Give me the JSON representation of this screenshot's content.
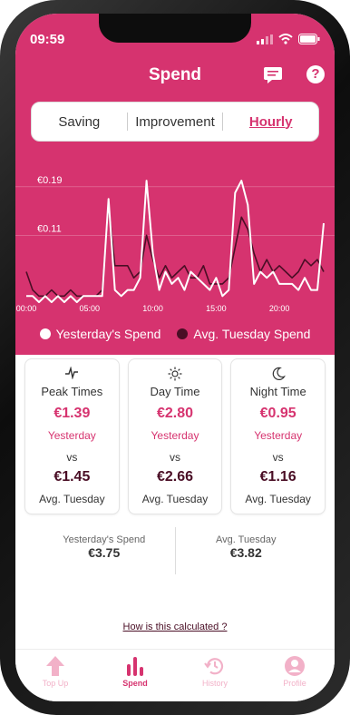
{
  "status": {
    "time": "09:59"
  },
  "header": {
    "title": "Spend"
  },
  "segments": [
    "Saving",
    "Improvement",
    "Hourly"
  ],
  "active_segment": "Hourly",
  "chart_data": {
    "type": "line",
    "x": [
      "00:00",
      "00:30",
      "01:00",
      "01:30",
      "02:00",
      "02:30",
      "03:00",
      "03:30",
      "04:00",
      "04:30",
      "05:00",
      "05:30",
      "06:00",
      "06:30",
      "07:00",
      "07:30",
      "08:00",
      "08:30",
      "09:00",
      "09:30",
      "10:00",
      "10:30",
      "11:00",
      "11:30",
      "12:00",
      "12:30",
      "13:00",
      "13:30",
      "14:00",
      "14:30",
      "15:00",
      "15:30",
      "16:00",
      "16:30",
      "17:00",
      "17:30",
      "18:00",
      "18:30",
      "19:00",
      "19:30",
      "20:00",
      "20:30",
      "21:00",
      "21:30",
      "22:00",
      "22:30",
      "23:00",
      "23:30"
    ],
    "series": [
      {
        "name": "Yesterday's Spend",
        "color": "#ffffff",
        "values": [
          0.01,
          0.01,
          0.0,
          0.01,
          0.0,
          0.01,
          0.0,
          0.01,
          0.0,
          0.01,
          0.01,
          0.01,
          0.01,
          0.17,
          0.02,
          0.01,
          0.02,
          0.02,
          0.04,
          0.2,
          0.08,
          0.02,
          0.05,
          0.03,
          0.04,
          0.02,
          0.05,
          0.04,
          0.03,
          0.02,
          0.04,
          0.01,
          0.02,
          0.18,
          0.2,
          0.16,
          0.03,
          0.05,
          0.04,
          0.05,
          0.03,
          0.03,
          0.03,
          0.02,
          0.04,
          0.02,
          0.02,
          0.13
        ]
      },
      {
        "name": "Avg. Tuesday Spend",
        "color": "#4a0e25",
        "values": [
          0.05,
          0.02,
          0.01,
          0.01,
          0.02,
          0.01,
          0.01,
          0.02,
          0.01,
          0.01,
          0.01,
          0.01,
          0.02,
          0.16,
          0.06,
          0.06,
          0.06,
          0.04,
          0.05,
          0.11,
          0.07,
          0.04,
          0.06,
          0.04,
          0.05,
          0.06,
          0.04,
          0.04,
          0.06,
          0.03,
          0.03,
          0.03,
          0.04,
          0.09,
          0.14,
          0.12,
          0.08,
          0.05,
          0.07,
          0.05,
          0.06,
          0.05,
          0.04,
          0.05,
          0.07,
          0.06,
          0.07,
          0.05
        ]
      }
    ],
    "y_ticks": [
      "€0.19",
      "€0.11"
    ],
    "x_ticks": [
      "00:00",
      "05:00",
      "10:00",
      "15:00",
      "20:00"
    ],
    "ylim": [
      0,
      0.23
    ]
  },
  "legend": {
    "yesterday": "Yesterday's Spend",
    "avg": "Avg. Tuesday Spend"
  },
  "cards": [
    {
      "title": "Peak Times",
      "value": "€1.39",
      "yesterday": "Yesterday",
      "vs": "vs",
      "avg_value": "€1.45",
      "avg_label": "Avg. Tuesday",
      "icon": "pulse-icon"
    },
    {
      "title": "Day Time",
      "value": "€2.80",
      "yesterday": "Yesterday",
      "vs": "vs",
      "avg_value": "€2.66",
      "avg_label": "Avg. Tuesday",
      "icon": "sun-icon"
    },
    {
      "title": "Night Time",
      "value": "€0.95",
      "yesterday": "Yesterday",
      "vs": "vs",
      "avg_value": "€1.16",
      "avg_label": "Avg. Tuesday",
      "icon": "moon-icon"
    }
  ],
  "totals": {
    "yesterday_label": "Yesterday's Spend",
    "yesterday_value": "€3.75",
    "avg_label": "Avg. Tuesday",
    "avg_value": "€3.82"
  },
  "how_link": "How is this calculated ?",
  "tabs": [
    {
      "label": "Top Up",
      "icon": "arrow-up-icon"
    },
    {
      "label": "Spend",
      "icon": "bar-chart-icon"
    },
    {
      "label": "History",
      "icon": "history-icon"
    },
    {
      "label": "Profile",
      "icon": "profile-icon"
    }
  ],
  "active_tab": "Spend",
  "colors": {
    "accent": "#d6336f",
    "dark": "#4a0e25",
    "tab_inactive": "#f2b1c8"
  }
}
